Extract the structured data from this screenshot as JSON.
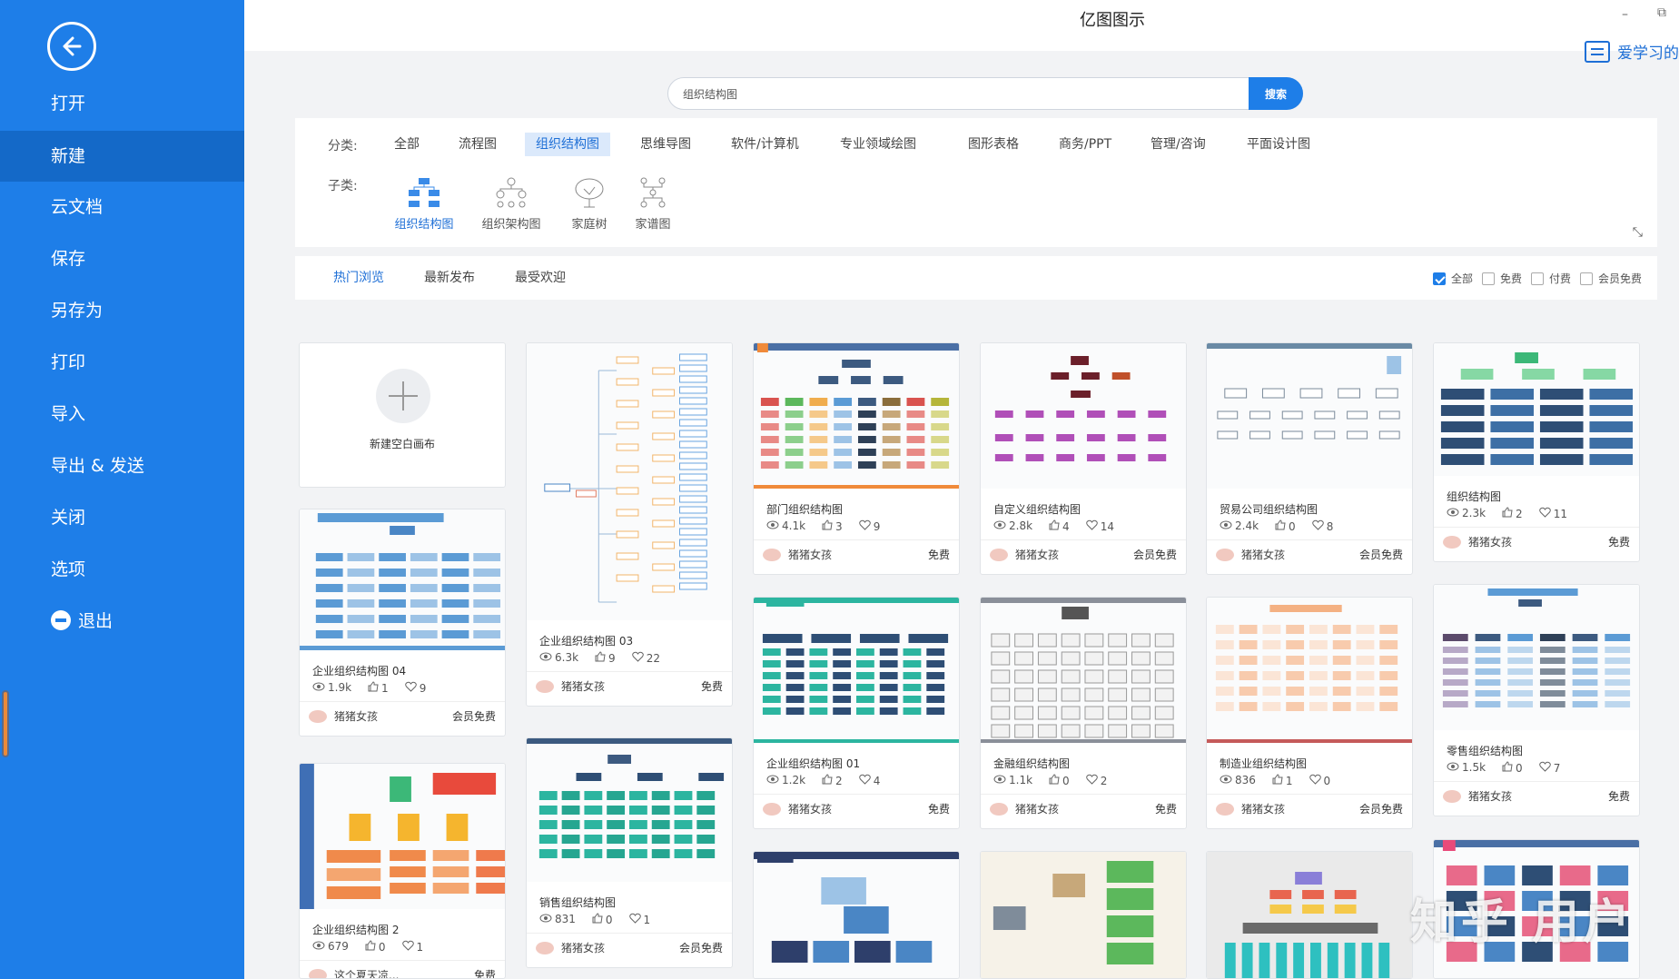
{
  "sidebar": {
    "items": [
      {
        "label": "打开"
      },
      {
        "label": "新建"
      },
      {
        "label": "云文档"
      },
      {
        "label": "保存"
      },
      {
        "label": "另存为"
      },
      {
        "label": "打印"
      },
      {
        "label": "导入"
      },
      {
        "label": "导出 & 发送"
      },
      {
        "label": "关闭"
      },
      {
        "label": "选项"
      },
      {
        "label": "退出"
      }
    ]
  },
  "titlebar": {
    "title": "亿图图示",
    "minimize": "–",
    "restore": "⧉",
    "user": "爱学习的"
  },
  "search": {
    "value": "组织结构图",
    "button": "搜索"
  },
  "categories": {
    "label": "分类:",
    "items": [
      "全部",
      "流程图",
      "组织结构图",
      "思维导图",
      "软件/计算机",
      "专业领域绘图",
      "图形表格",
      "商务/PPT",
      "管理/咨询",
      "平面设计图"
    ],
    "sub_label": "子类:",
    "subs": [
      "组织结构图",
      "组织架构图",
      "家庭树",
      "家谱图"
    ]
  },
  "sort": {
    "items": [
      "热门浏览",
      "最新发布",
      "最受欢迎"
    ],
    "filters": [
      "全部",
      "免费",
      "付费",
      "会员免费"
    ]
  },
  "new_blank": "新建空白画布",
  "cards": [
    {
      "title": "企业组织结构图 04",
      "views": "1.9k",
      "likes": "1",
      "favs": "9",
      "author": "猪猪女孩",
      "price": "会员免费"
    },
    {
      "title": "企业组织结构图 2",
      "views": "679",
      "likes": "0",
      "favs": "1",
      "author": "这个夏天凉...",
      "price": "免费"
    },
    {
      "title": "企业组织结构图 03",
      "views": "6.3k",
      "likes": "9",
      "favs": "22",
      "author": "猪猪女孩",
      "price": "免费"
    },
    {
      "title": "销售组织结构图",
      "views": "831",
      "likes": "0",
      "favs": "1",
      "author": "猪猪女孩",
      "price": "会员免费"
    },
    {
      "title": "部门组织结构图",
      "views": "4.1k",
      "likes": "3",
      "favs": "9",
      "author": "猪猪女孩",
      "price": "免费"
    },
    {
      "title": "企业组织结构图 01",
      "views": "1.2k",
      "likes": "2",
      "favs": "4",
      "author": "猪猪女孩",
      "price": "免费"
    },
    {
      "title": "自定义组织结构图",
      "views": "2.8k",
      "likes": "4",
      "favs": "14",
      "author": "猪猪女孩",
      "price": "会员免费"
    },
    {
      "title": "金融组织结构图",
      "views": "1.1k",
      "likes": "0",
      "favs": "2",
      "author": "猪猪女孩",
      "price": "免费"
    },
    {
      "title": "贸易公司组织结构图",
      "views": "2.4k",
      "likes": "0",
      "favs": "8",
      "author": "猪猪女孩",
      "price": "会员免费"
    },
    {
      "title": "制造业组织结构图",
      "views": "836",
      "likes": "1",
      "favs": "0",
      "author": "猪猪女孩",
      "price": "会员免费"
    },
    {
      "title": "组织结构图",
      "views": "2.3k",
      "likes": "2",
      "favs": "11",
      "author": "猪猪女孩",
      "price": "免费"
    },
    {
      "title": "零售组织结构图",
      "views": "1.5k",
      "likes": "0",
      "favs": "7",
      "author": "猪猪女孩",
      "price": "免费"
    }
  ],
  "watermark": "知乎 用户",
  "colors": {
    "sidebar": "#1e7ee8",
    "sidebar_active": "#1469c8",
    "accent": "#1e6fd6"
  }
}
